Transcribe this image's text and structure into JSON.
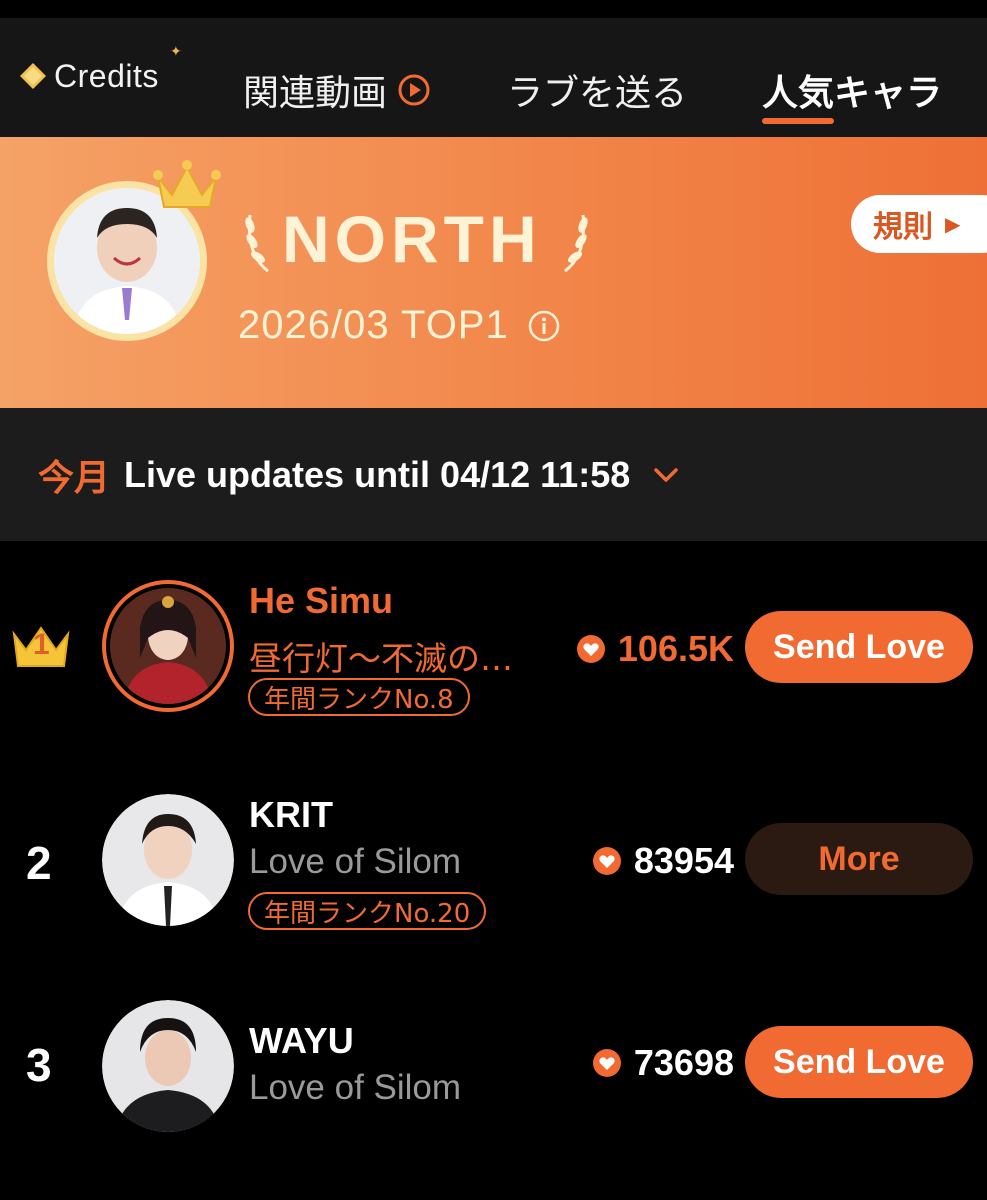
{
  "nav": {
    "credits_label": "Credits",
    "tabs": [
      {
        "label": "関連動画"
      },
      {
        "label": "ラブを送る"
      },
      {
        "label": "人気キャラ"
      }
    ]
  },
  "banner": {
    "name": "NORTH",
    "subtitle": "2026/03 TOP1",
    "rules_label": "規則"
  },
  "period": {
    "label": "今月",
    "text": "Live updates until 04/12 11:58"
  },
  "ranking": [
    {
      "rank": "1",
      "name": "He Simu",
      "work": "昼行灯〜不滅の…",
      "year_rank": "年間ランクNo.8",
      "love": "106.5K",
      "action": "Send Love"
    },
    {
      "rank": "2",
      "name": "KRIT",
      "work": "Love of Silom",
      "year_rank": "年間ランクNo.20",
      "love": "83954",
      "action": "More"
    },
    {
      "rank": "3",
      "name": "WAYU",
      "work": "Love of Silom",
      "year_rank": "",
      "love": "73698",
      "action": "Send Love"
    }
  ],
  "colors": {
    "accent": "#f06a32",
    "banner_text": "#fff3d6",
    "nav_bg": "#161616",
    "period_bg": "#1c1c1c"
  }
}
